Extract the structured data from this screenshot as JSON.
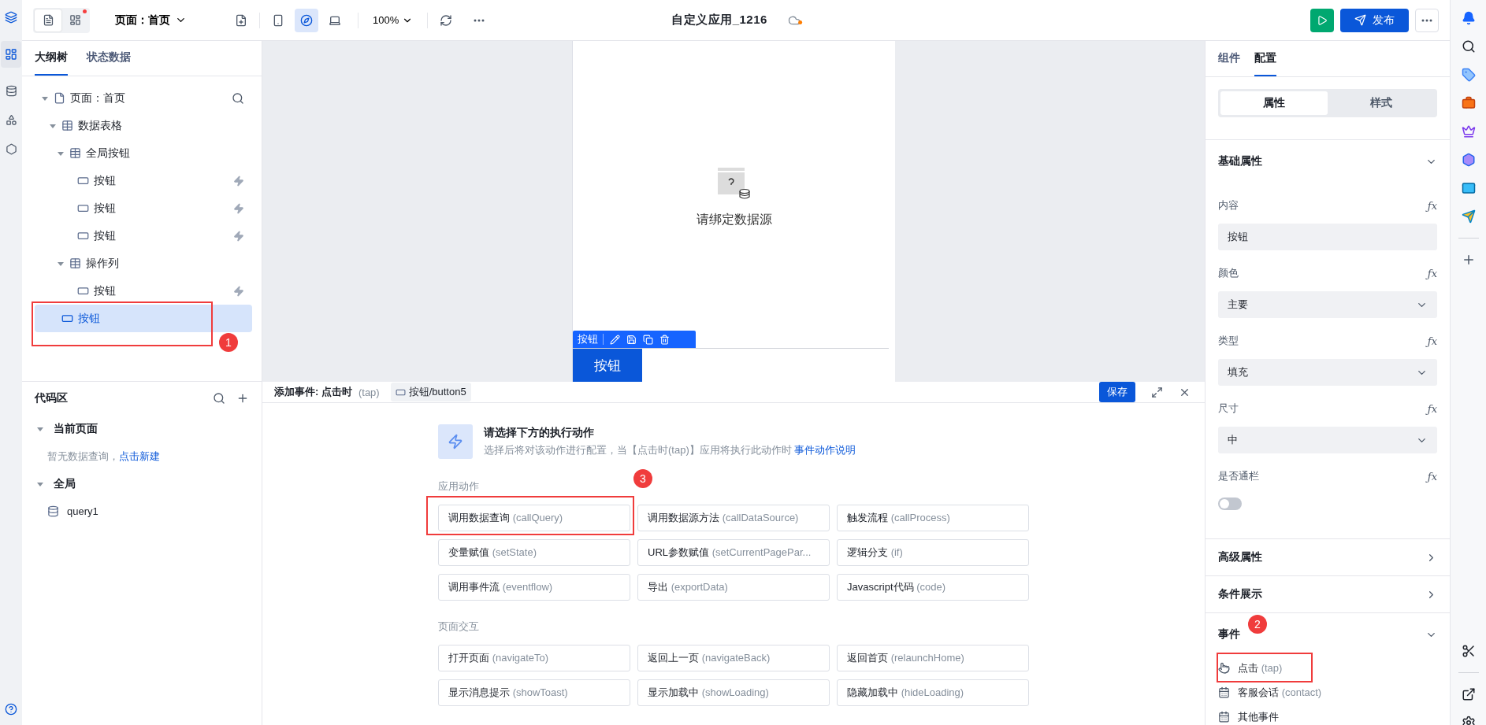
{
  "toolbar": {
    "view_modes": [
      {
        "kind": "outline",
        "selected": true,
        "notify": false
      },
      {
        "kind": "layout",
        "selected": false,
        "notify": true
      }
    ],
    "page_select": "页面：首页",
    "devices": [
      {
        "kind": "phone",
        "selected": false
      },
      {
        "kind": "tablet",
        "selected": true
      },
      {
        "kind": "desktop",
        "selected": false
      }
    ],
    "zoom": "100%",
    "title": "自定义应用_1216",
    "unsaved": true,
    "publish": "发布"
  },
  "outline": {
    "tabs": [
      {
        "label": "大纲树",
        "selected": true
      },
      {
        "label": "状态数据",
        "selected": false
      }
    ],
    "tree": [
      {
        "label": "页面：首页",
        "kind": "page",
        "expanded": true,
        "selected": false,
        "children": [
          {
            "label": "数据表格",
            "kind": "table",
            "expanded": true,
            "selected": false,
            "children": [
              {
                "label": "全局按钮",
                "kind": "table",
                "expanded": true,
                "selected": false,
                "children": [
                  {
                    "label": "按钮",
                    "kind": "button",
                    "selected": false,
                    "has_event": true
                  },
                  {
                    "label": "按钮",
                    "kind": "button",
                    "selected": false,
                    "has_event": true
                  },
                  {
                    "label": "按钮",
                    "kind": "button",
                    "selected": false,
                    "has_event": true
                  }
                ]
              },
              {
                "label": "操作列",
                "kind": "table",
                "expanded": true,
                "selected": false,
                "children": [
                  {
                    "label": "按钮",
                    "kind": "button",
                    "selected": false,
                    "has_event": true
                  }
                ]
              }
            ]
          },
          {
            "label": "按钮",
            "kind": "button",
            "selected": true,
            "has_event": false,
            "outlined": true,
            "callout": "1"
          }
        ]
      }
    ]
  },
  "code_area": {
    "title": "代码区",
    "groups": [
      {
        "label": "当前页面",
        "expanded": true,
        "empty_text": "暂无数据查询，",
        "empty_link": "点击新建"
      },
      {
        "label": "全局",
        "expanded": true,
        "items": [
          "query1"
        ]
      }
    ]
  },
  "canvas": {
    "empty_text": "请绑定数据源",
    "selection_label": "按钮",
    "button": "按钮"
  },
  "event_panel": {
    "title": "添加事件: 点击时",
    "title_hint": "(tap)",
    "target": "按钮/button5",
    "save": "保存",
    "prompt_title": "请选择下方的执行动作",
    "prompt_text": "选择后将对该动作进行配置，当【点击时(tap)】应用将执行此动作时",
    "prompt_link": "事件动作说明",
    "groups": [
      {
        "title": "应用动作",
        "actions": [
          {
            "label": "调用数据查询",
            "code": "(callQuery)",
            "outlined": true,
            "callout": "3"
          },
          {
            "label": "调用数据源方法",
            "code": "(callDataSource)",
            "outlined": false
          },
          {
            "label": "触发流程",
            "code": "(callProcess)",
            "outlined": false
          },
          {
            "label": "变量赋值",
            "code": "(setState)",
            "outlined": false
          },
          {
            "label": "URL参数赋值",
            "code": "(setCurrentPagePar...",
            "outlined": false
          },
          {
            "label": "逻辑分支",
            "code": "(if)",
            "outlined": false
          },
          {
            "label": "调用事件流",
            "code": "(eventflow)",
            "outlined": false
          },
          {
            "label": "导出",
            "code": "(exportData)",
            "outlined": false
          },
          {
            "label": "Javascript代码",
            "code": "(code)",
            "outlined": false
          }
        ]
      },
      {
        "title": "页面交互",
        "actions": [
          {
            "label": "打开页面",
            "code": "(navigateTo)",
            "outlined": false
          },
          {
            "label": "返回上一页",
            "code": "(navigateBack)",
            "outlined": false
          },
          {
            "label": "返回首页",
            "code": "(relaunchHome)",
            "outlined": false
          },
          {
            "label": "显示消息提示",
            "code": "(showToast)",
            "outlined": false
          },
          {
            "label": "显示加载中",
            "code": "(showLoading)",
            "outlined": false
          },
          {
            "label": "隐藏加载中",
            "code": "(hideLoading)",
            "outlined": false
          }
        ]
      }
    ]
  },
  "config": {
    "tabs": [
      {
        "label": "组件",
        "selected": false
      },
      {
        "label": "配置",
        "selected": true
      }
    ],
    "segments": [
      {
        "label": "属性",
        "selected": true
      },
      {
        "label": "样式",
        "selected": false
      }
    ],
    "sections": [
      {
        "title": "基础属性",
        "expanded": true,
        "fields": [
          {
            "kind": "input",
            "label": "内容",
            "fx": "ƒx",
            "value": "按钮"
          },
          {
            "kind": "select",
            "label": "颜色",
            "fx": "ƒx",
            "value": "主要"
          },
          {
            "kind": "select",
            "label": "类型",
            "fx": "ƒx",
            "value": "填充"
          },
          {
            "kind": "select",
            "label": "尺寸",
            "fx": "ƒx",
            "value": "中"
          },
          {
            "kind": "switch",
            "label": "是否通栏",
            "fx": "ƒx",
            "on": false
          }
        ]
      },
      {
        "title": "高级属性",
        "expanded": false
      },
      {
        "title": "条件展示",
        "expanded": false
      },
      {
        "title": "事件",
        "expanded": true,
        "callout": "2",
        "events": [
          {
            "kind": "tap",
            "label": "点击",
            "hint": "(tap)",
            "outlined": true
          },
          {
            "kind": "calendar",
            "label": "客服会话",
            "hint": "(contact)",
            "outlined": false
          },
          {
            "kind": "calendar",
            "label": "其他事件",
            "outlined": false
          }
        ]
      }
    ]
  }
}
